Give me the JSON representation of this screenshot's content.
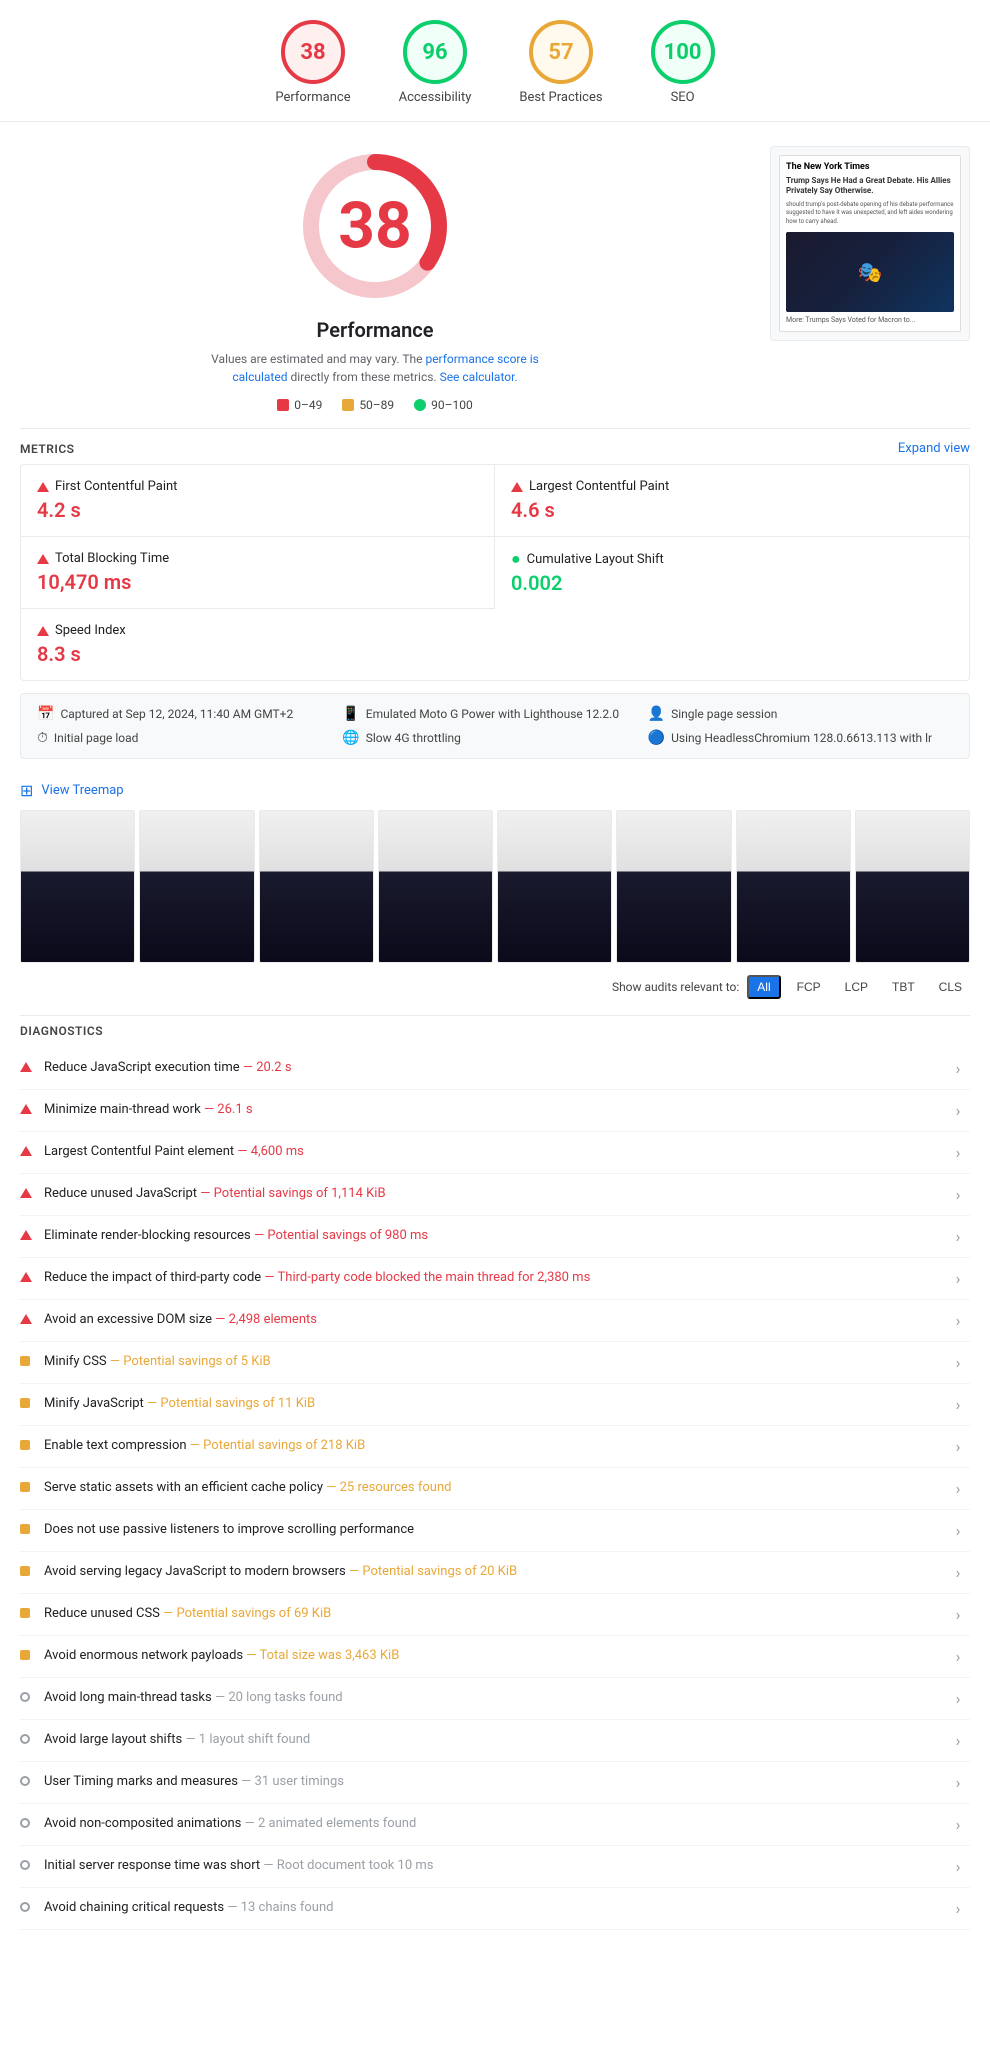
{
  "scores": [
    {
      "id": "performance",
      "value": "38",
      "label": "Performance",
      "type": "red"
    },
    {
      "id": "accessibility",
      "value": "96",
      "label": "Accessibility",
      "type": "green-light"
    },
    {
      "id": "best-practices",
      "value": "57",
      "label": "Best Practices",
      "type": "orange"
    },
    {
      "id": "seo",
      "value": "100",
      "label": "SEO",
      "type": "green"
    }
  ],
  "performance": {
    "score": "38",
    "title": "Performance",
    "desc_start": "Values are estimated and may vary. The ",
    "desc_link": "performance score is calculated",
    "desc_mid": " directly from these metrics. ",
    "desc_link2": "See calculator.",
    "legend": [
      {
        "label": "0–49",
        "color": "#e63946"
      },
      {
        "label": "50–89",
        "color": "#e8a838"
      },
      {
        "label": "90–100",
        "color": "#0cce6b"
      }
    ]
  },
  "metrics": {
    "section_title": "METRICS",
    "expand_label": "Expand view",
    "items": [
      {
        "label": "First Contentful Paint",
        "value": "4.2 s",
        "color": "red",
        "icon": "triangle"
      },
      {
        "label": "Largest Contentful Paint",
        "value": "4.6 s",
        "color": "red",
        "icon": "triangle"
      },
      {
        "label": "Total Blocking Time",
        "value": "10,470 ms",
        "color": "red",
        "icon": "triangle"
      },
      {
        "label": "Cumulative Layout Shift",
        "value": "0.002",
        "color": "green",
        "icon": "dot"
      },
      {
        "label": "Speed Index",
        "value": "8.3 s",
        "color": "red",
        "icon": "triangle",
        "full": true
      }
    ]
  },
  "capture": {
    "items": [
      {
        "icon": "📅",
        "text": "Captured at Sep 12, 2024, 11:40 AM GMT+2"
      },
      {
        "icon": "📱",
        "text": "Emulated Moto G Power with Lighthouse 12.2.0"
      },
      {
        "icon": "👤",
        "text": "Single page session"
      },
      {
        "icon": "⏱",
        "text": "Initial page load"
      },
      {
        "icon": "🌐",
        "text": "Slow 4G throttling"
      },
      {
        "icon": "🔵",
        "text": "Using HeadlessChromium 128.0.6613.113 with lr"
      }
    ]
  },
  "treemap": {
    "label": "View Treemap"
  },
  "filter": {
    "label": "Show audits relevant to:",
    "buttons": [
      "All",
      "FCP",
      "LCP",
      "TBT",
      "CLS"
    ]
  },
  "diagnostics": {
    "section_title": "DIAGNOSTICS",
    "items": [
      {
        "icon": "triangle-red",
        "text": "Reduce JavaScript execution time",
        "detail": " — 20.2 s",
        "detail_class": "red"
      },
      {
        "icon": "triangle-red",
        "text": "Minimize main-thread work",
        "detail": " — 26.1 s",
        "detail_class": "red"
      },
      {
        "icon": "triangle-red",
        "text": "Largest Contentful Paint element",
        "detail": " — 4,600 ms",
        "detail_class": "red"
      },
      {
        "icon": "triangle-red",
        "text": "Reduce unused JavaScript",
        "detail": " — Potential savings of 1,114 KiB",
        "detail_class": "red"
      },
      {
        "icon": "triangle-red",
        "text": "Eliminate render-blocking resources",
        "detail": " — Potential savings of 980 ms",
        "detail_class": "red"
      },
      {
        "icon": "triangle-red",
        "text": "Reduce the impact of third-party code",
        "detail": " — Third-party code blocked the main thread for 2,380 ms",
        "detail_class": "red"
      },
      {
        "icon": "triangle-red",
        "text": "Avoid an excessive DOM size",
        "detail": " — 2,498 elements",
        "detail_class": "red"
      },
      {
        "icon": "square-orange",
        "text": "Minify CSS",
        "detail": " — Potential savings of 5 KiB",
        "detail_class": "orange"
      },
      {
        "icon": "square-orange",
        "text": "Minify JavaScript",
        "detail": " — Potential savings of 11 KiB",
        "detail_class": "orange"
      },
      {
        "icon": "square-orange",
        "text": "Enable text compression",
        "detail": " — Potential savings of 218 KiB",
        "detail_class": "orange"
      },
      {
        "icon": "square-orange",
        "text": "Serve static assets with an efficient cache policy",
        "detail": " — 25 resources found",
        "detail_class": "orange"
      },
      {
        "icon": "square-orange",
        "text": "Does not use passive listeners to improve scrolling performance",
        "detail": "",
        "detail_class": ""
      },
      {
        "icon": "square-orange",
        "text": "Avoid serving legacy JavaScript to modern browsers",
        "detail": " — Potential savings of 20 KiB",
        "detail_class": "orange"
      },
      {
        "icon": "square-orange",
        "text": "Reduce unused CSS",
        "detail": " — Potential savings of 69 KiB",
        "detail_class": "orange"
      },
      {
        "icon": "square-orange",
        "text": "Avoid enormous network payloads",
        "detail": " — Total size was 3,463 KiB",
        "detail_class": "orange"
      },
      {
        "icon": "circle-gray",
        "text": "Avoid long main-thread tasks",
        "detail": " — 20 long tasks found",
        "detail_class": ""
      },
      {
        "icon": "circle-gray",
        "text": "Avoid large layout shifts",
        "detail": " — 1 layout shift found",
        "detail_class": ""
      },
      {
        "icon": "circle-gray",
        "text": "User Timing marks and measures",
        "detail": " — 31 user timings",
        "detail_class": ""
      },
      {
        "icon": "circle-gray",
        "text": "Avoid non-composited animations",
        "detail": " — 2 animated elements found",
        "detail_class": ""
      },
      {
        "icon": "circle-gray",
        "text": "Initial server response time was short",
        "detail": " — Root document took 10 ms",
        "detail_class": ""
      },
      {
        "icon": "circle-gray",
        "text": "Avoid chaining critical requests",
        "detail": " — 13 chains found",
        "detail_class": ""
      }
    ]
  }
}
